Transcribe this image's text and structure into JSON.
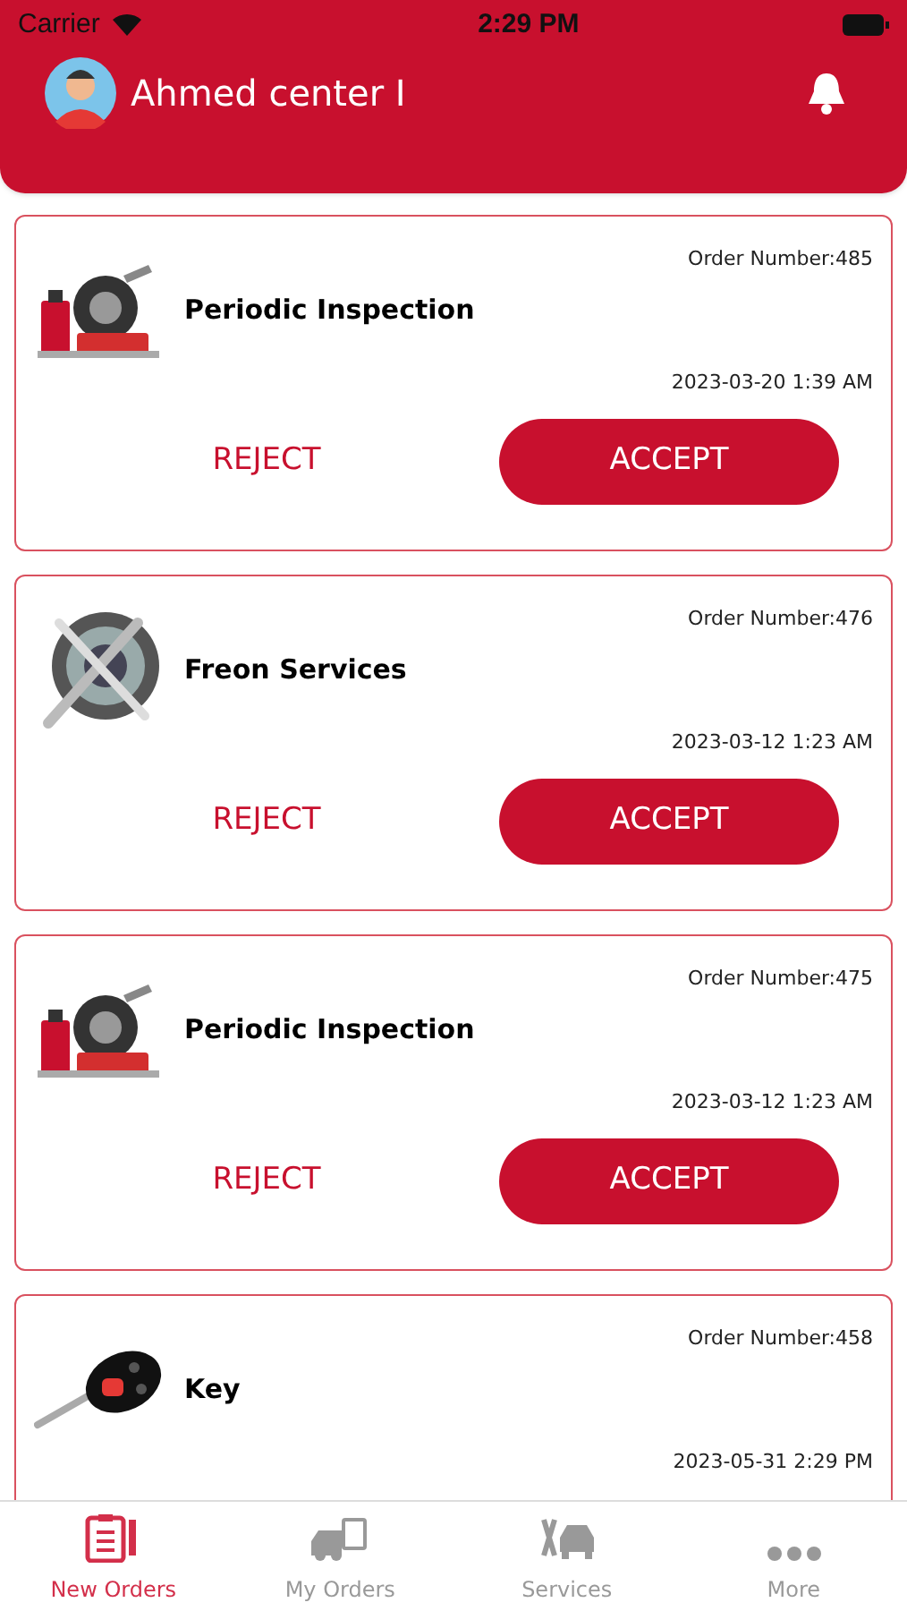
{
  "status_bar": {
    "carrier": "Carrier",
    "time": "2:29 PM"
  },
  "header": {
    "title": "Ahmed center I"
  },
  "orders": [
    {
      "kind": "tools",
      "title": "Periodic Inspection",
      "order_number": "Order Number:485",
      "date": "2023-03-20 1:39 AM",
      "reject": "REJECT",
      "accept": "ACCEPT"
    },
    {
      "kind": "ac",
      "title": "Freon Services",
      "order_number": "Order Number:476",
      "date": "2023-03-12 1:23 AM",
      "reject": "REJECT",
      "accept": "ACCEPT"
    },
    {
      "kind": "tools",
      "title": "Periodic Inspection",
      "order_number": "Order Number:475",
      "date": "2023-03-12 1:23 AM",
      "reject": "REJECT",
      "accept": "ACCEPT"
    },
    {
      "kind": "key",
      "title": "Key",
      "order_number": "Order Number:458",
      "date": "2023-05-31 2:29 PM"
    }
  ],
  "tabs": [
    {
      "kind": "clipboard",
      "label": "New Orders",
      "selected": true
    },
    {
      "kind": "truck",
      "label": "My Orders",
      "selected": false
    },
    {
      "kind": "service",
      "label": "Services",
      "selected": false
    },
    {
      "kind": "more",
      "label": "More",
      "selected": false
    }
  ]
}
